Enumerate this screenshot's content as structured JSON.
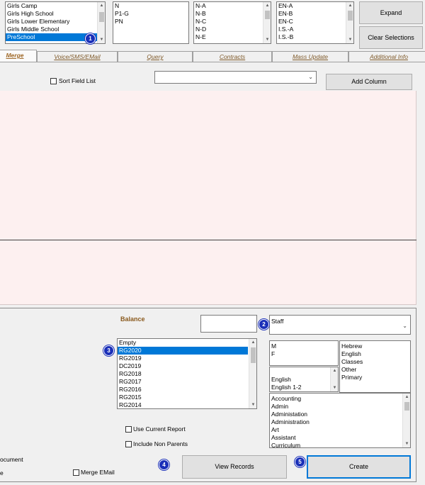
{
  "top_lists": {
    "list1": {
      "items": [
        "Girls Camp",
        "Girls High School",
        "Girls Lower Elementary",
        "Girls Middle School",
        "PreSchool"
      ],
      "selected_index": 4
    },
    "list2": {
      "items": [
        "N",
        "P1-G",
        "PN"
      ]
    },
    "list3": {
      "items": [
        "N-A",
        "N-B",
        "N-C",
        "N-D",
        "N-E"
      ]
    },
    "list4": {
      "items": [
        "EN-A",
        "EN-B",
        "EN-C",
        "I.S.-A",
        "I.S.-B"
      ]
    }
  },
  "buttons": {
    "expand": "Expand",
    "clear_selections": "Clear Selections",
    "add_column": "Add Column",
    "view_records": "View Records",
    "create": "Create"
  },
  "tabs": [
    {
      "label": "Merge",
      "active": true
    },
    {
      "label": "Voice/SMS/EMail",
      "active": false
    },
    {
      "label": "Query",
      "active": false
    },
    {
      "label": "Contracts",
      "active": false
    },
    {
      "label": "Mass Update",
      "active": false
    },
    {
      "label": "Additional Info",
      "active": false
    }
  ],
  "sort_field_list_label": "Sort Field List",
  "field_combo_value": "",
  "balance_label": "Balance",
  "balance_value": "",
  "staff_combo_value": "Staff",
  "year_list": {
    "items": [
      "Empty",
      "RG2020",
      "RG2019",
      "DC2019",
      "RG2018",
      "RG2017",
      "RG2016",
      "RG2015",
      "RG2014"
    ],
    "selected_index": 1
  },
  "gender_list": {
    "items": [
      "M",
      "F"
    ]
  },
  "subject_type_list": {
    "items": [
      "Hebrew",
      "English",
      "Classes",
      "Other",
      "Primary"
    ]
  },
  "english_list": {
    "items": [
      "English",
      "English 1-2"
    ]
  },
  "department_list": {
    "items": [
      "Accounting",
      "Admin",
      "Administation",
      "Administration",
      "Art",
      "Assistant",
      "Curriculum"
    ]
  },
  "use_current_report_label": "Use Current Report",
  "include_non_parents_label": "Include Non Parents",
  "document_label_fragment": "ocument",
  "e_label_fragment": "e",
  "merge_email_label": "Merge EMail",
  "badges": [
    "1",
    "2",
    "3",
    "4",
    "5"
  ],
  "colors": {
    "selection": "#0078d7",
    "grid_bg": "#fdf0f0",
    "tab_text": "#7f5a2a",
    "balance_text": "#8a5a1e",
    "badge": "#1a2fb8"
  }
}
